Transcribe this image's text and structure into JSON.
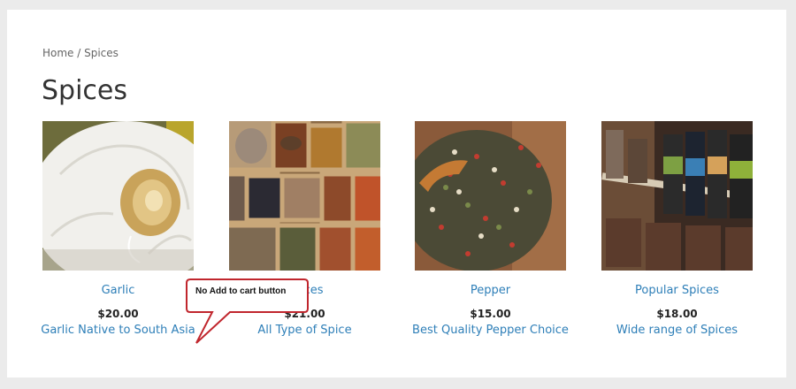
{
  "breadcrumb": {
    "home": "Home",
    "separator": " / ",
    "current": "Spices"
  },
  "page_title": "Spices",
  "products": [
    {
      "name": "Garlic",
      "price": "$20.00",
      "description": "Garlic Native to South Asia",
      "image_icon": "garlic-photo"
    },
    {
      "name": "Spices",
      "price": "$21.00",
      "description": "All Type of Spice",
      "image_icon": "spice-boxes-photo"
    },
    {
      "name": "Pepper",
      "price": "$15.00",
      "description": "Best Quality Pepper Choice",
      "image_icon": "peppercorns-photo"
    },
    {
      "name": "Popular Spices",
      "price": "$18.00",
      "description": "Wide range of Spices",
      "image_icon": "spice-shelf-photo"
    }
  ],
  "annotation": {
    "text": "No Add to cart button",
    "border_color": "#c0262d"
  },
  "colors": {
    "link": "#2e7fb8",
    "background": "#ebebeb"
  }
}
